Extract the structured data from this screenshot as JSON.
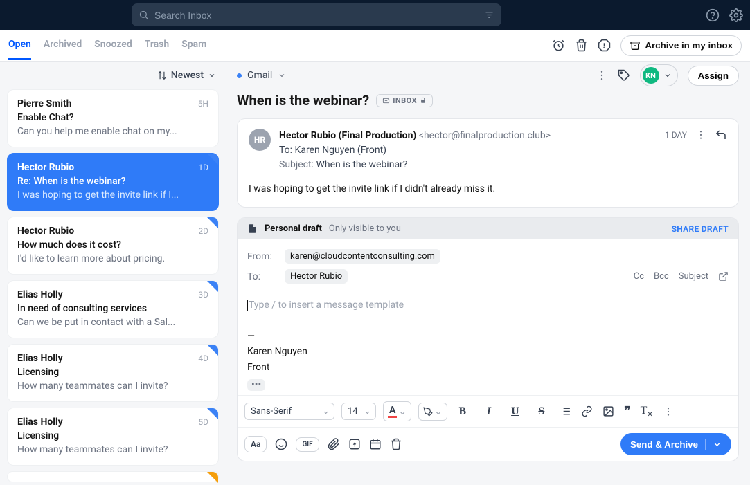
{
  "topbar": {
    "search_placeholder": "Search Inbox"
  },
  "tabs": {
    "items": [
      "Open",
      "Archived",
      "Snoozed",
      "Trash",
      "Spam"
    ],
    "archive_button": "Archive in my inbox"
  },
  "sort": {
    "label": "Newest"
  },
  "conversations": [
    {
      "sender": "Pierre Smith",
      "time": "5H",
      "subject": "Enable Chat?",
      "preview": "Can you help me enable chat on my...",
      "selected": false,
      "corner": "none"
    },
    {
      "sender": "Hector Rubio",
      "time": "1D",
      "subject": "Re: When is the webinar?",
      "preview": "I was hoping to get the invite link if I...",
      "selected": true,
      "corner": "blue"
    },
    {
      "sender": "Hector Rubio",
      "time": "2D",
      "subject": "How much does it cost?",
      "preview": "I'd like to learn more about pricing.",
      "selected": false,
      "corner": "blue"
    },
    {
      "sender": "Elias Holly",
      "time": "3D",
      "subject": "In need of consulting services",
      "preview": "Can we be put in contact with a Sal...",
      "selected": false,
      "corner": "blue"
    },
    {
      "sender": "Elias Holly",
      "time": "4D",
      "subject": "Licensing",
      "preview": "How many teammates can I invite?",
      "selected": false,
      "corner": "blue"
    },
    {
      "sender": "Elias Holly",
      "time": "5D",
      "subject": "Licensing",
      "preview": "How many teammates can I invite?",
      "selected": false,
      "corner": "blue"
    },
    {
      "sender": "",
      "time": "",
      "subject": "",
      "preview": "",
      "selected": false,
      "corner": "orange"
    }
  ],
  "reader": {
    "channel_label": "Gmail",
    "assign_label": "Assign",
    "avatar_initials": "KN",
    "subject": "When is the webinar?",
    "badge_label": "INBOX",
    "message": {
      "avatar_initials": "HR",
      "sender_name": "Hector Rubio (Final Production)",
      "sender_email": "<hector@finalproduction.club>",
      "to_label": "To:",
      "to_value": "Karen Nguyen (Front)",
      "subject_label": "Subject:",
      "subject_value": "When is the webinar?",
      "age": "1 DAY",
      "body": "I was hoping to get the invite link if I didn't already miss it."
    }
  },
  "compose": {
    "draft_title": "Personal draft",
    "draft_visibility": "Only visible to you",
    "share_label": "SHARE DRAFT",
    "from_label": "From:",
    "from_value": "karen@cloudcontentconsulting.com",
    "to_label": "To:",
    "to_value": "Hector Rubio",
    "cc_label": "Cc",
    "bcc_label": "Bcc",
    "subject_label": "Subject",
    "body_placeholder": "Type / to insert a message template",
    "signature_divider": "—",
    "signature_name": "Karen Nguyen",
    "signature_company": "Front",
    "format": {
      "font_family": "Sans-Serif",
      "font_size": "14"
    },
    "send_label": "Send & Archive"
  }
}
